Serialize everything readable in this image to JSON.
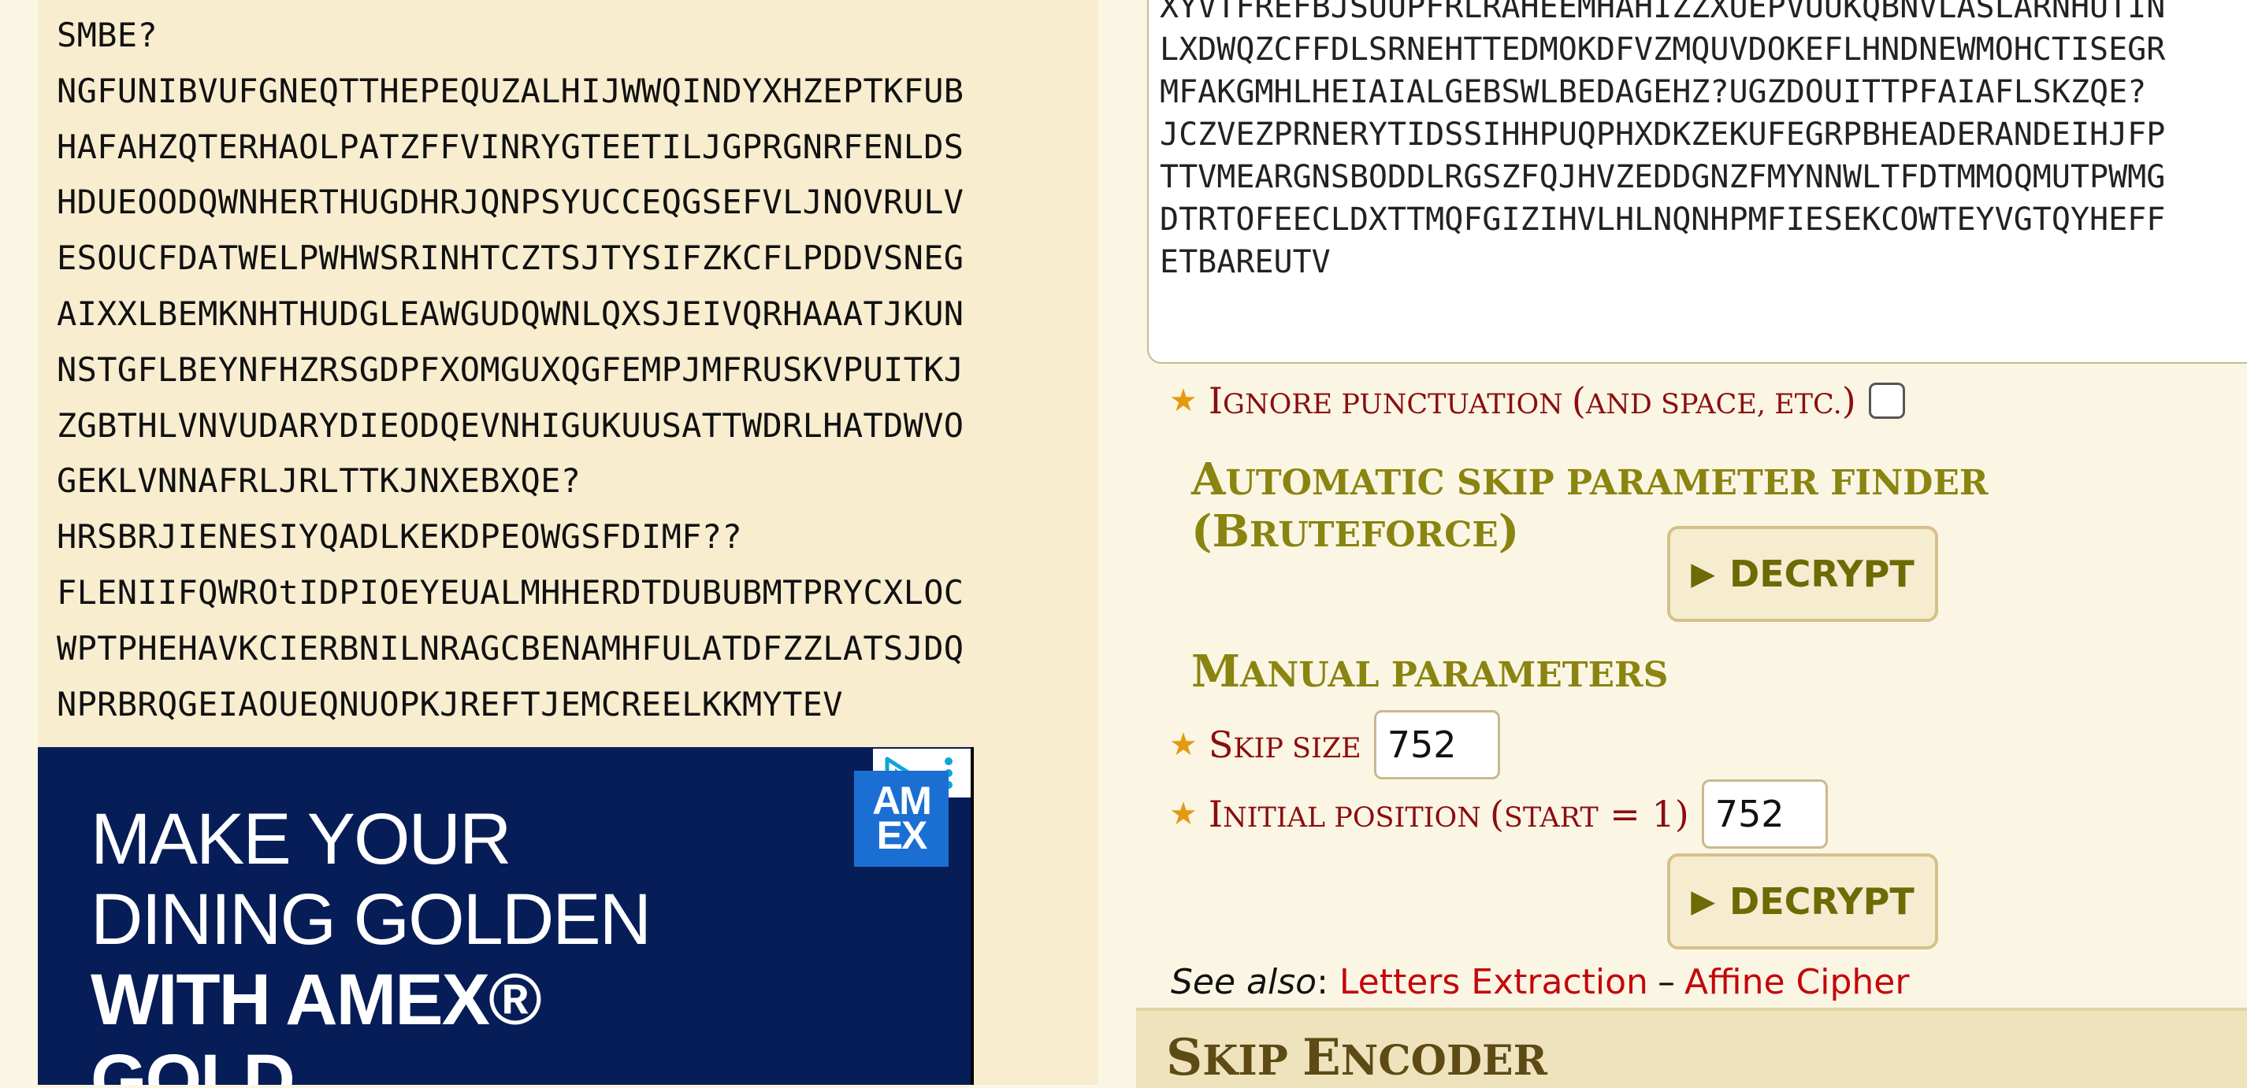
{
  "left": {
    "result_lines": [
      "SMBE?",
      "NGFUNIBVUFGNEQTTHEPEQUZALHIJWWQINDYXHZEPTKFUB",
      "HAFAHZQTERHAOLPATZFFVINRYGTEETILJGPRGNRFENLDS",
      "HDUEOODQWNHERTHUGDHRJQNPSYUCCEQGSEFVLJNOVRULV",
      "ESOUCFDATWELPWHWSRINHTCZTSJTYSIFZKCFLPDDVSNEG",
      "AIXXLBEMKNHTHUDGLEAWGUDQWNLQXSJEIVQRHAAATJKUN",
      "NSTGFLBEYNFHZRSGDPFXOMGUXQGFEMPJMFRUSKVPUITKJ",
      "ZGBTHLVNVUDARYDIEODQEVNHIGUKUUSATTWDRLHATDWVO",
      "GEKLVNNAFRLJRLTTKJNXEBXQE?",
      "HRSBRJIENESIYQADLKEKDPEOWGSFDIMF??",
      "FLENIIFQWROtIDPIOEYEUALMHHERDTDUBUBMTPRYCXLOC",
      "WPTPHEHAVKCIERBNILNRAGCBENAMHFULATDFZZLATSJDQ",
      "NPRBRQGEIAOUEQNUOPKJREFTJEMCREELKKMYTEV"
    ],
    "ad": {
      "line1": "MAKE YOUR",
      "line2": "DINING GOLDEN",
      "line3": "WITH AMEX®",
      "line4": "GOLD.",
      "logo_top": "AM",
      "logo_bottom": "EX",
      "choices_icon": "ad-choices-icon",
      "more_icon": "more-vertical-icon"
    }
  },
  "right": {
    "ciphertext_lines": [
      "XYVTFREFBJSUUPFRLRAHEEMHAHIZZXUEPVUUKQBNVLASLARNHUTIN",
      "LXDWQZCFFDLSRNEHTTEDMOKDFVZMQUVDOKEFLHNDNEWMOHCTISEGR",
      "MFAKGMHLHEIAIALGEBSWLBEDAGEHZ?UGZDOUITTPFAIAFLSKZQE?",
      "JCZVEZPRNERYTIDSSIHHPUQPHXDKZEKUFEGRPBHEADERANDEIHJFP",
      "TTVMEARGNSBODDLRGSZFQJHVZEDDGNZFMYNNWLTFDTMMOQMUTPWMG",
      "DTRTOFEECLDXTTMQFGIZIHVLHLNQNHPMFIESEKCOWTEYVGTQYHEFF",
      "ETBAREUTV"
    ],
    "ignore_punct": {
      "I": "I",
      "gnore": "GNORE PUNCTUATION ",
      "open": "(",
      "and": "AND SPACE",
      "etc": ", ETC.",
      "close": ")"
    },
    "auto_heading": {
      "A": "A",
      "utomatic": "UTOMATIC SKIP PARAMETER FINDER ",
      "open": "(",
      "B": "B",
      "ruteforce": "RUTEFORCE",
      "close": ")"
    },
    "decrypt_label": "DECRYPT",
    "manual_heading": {
      "M": "M",
      "anual": "ANUAL PARAMETERS"
    },
    "skip_size": {
      "S": "S",
      "kip": "KIP SIZE",
      "value": "752"
    },
    "initial_position": {
      "I": "I",
      "nitial": "NITIAL POSITION ",
      "open": "(",
      "start": "START",
      "eq": " = 1",
      "close": ")",
      "value": "752"
    },
    "see_also": {
      "label": "See also",
      "colon": ":",
      "link1": "Letters Extraction",
      "dash": "–",
      "link2": "Affine Cipher"
    },
    "encoder": {
      "S": "S",
      "kip": "KIP ",
      "E": "E",
      "ncoder": "NCODER"
    },
    "colors": {
      "accent_red": "#8b0d10",
      "heading_olive": "#8a8410",
      "star": "#e49a10",
      "link_red": "#c4070c"
    }
  }
}
